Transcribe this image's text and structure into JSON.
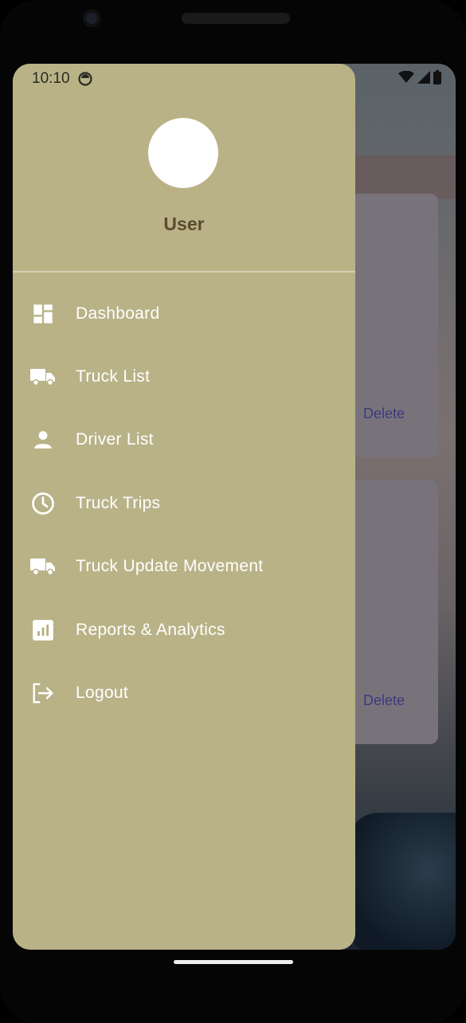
{
  "status_bar": {
    "time": "10:10"
  },
  "drawer": {
    "username": "User",
    "menu": [
      {
        "label": "Dashboard",
        "icon": "dashboard-icon"
      },
      {
        "label": "Truck List",
        "icon": "truck-icon"
      },
      {
        "label": "Driver List",
        "icon": "person-icon"
      },
      {
        "label": "Truck Trips",
        "icon": "clock-icon"
      },
      {
        "label": "Truck Update Movement",
        "icon": "truck-icon"
      },
      {
        "label": "Reports & Analytics",
        "icon": "analytics-icon"
      },
      {
        "label": "Logout",
        "icon": "logout-icon"
      }
    ]
  },
  "background": {
    "cards": [
      {
        "delete_label": "Delete"
      },
      {
        "delete_label": "Delete"
      }
    ]
  },
  "colors": {
    "drawer_bg": "#b9b287",
    "username_color": "#5c4b2f",
    "menu_text": "#ffffff"
  }
}
